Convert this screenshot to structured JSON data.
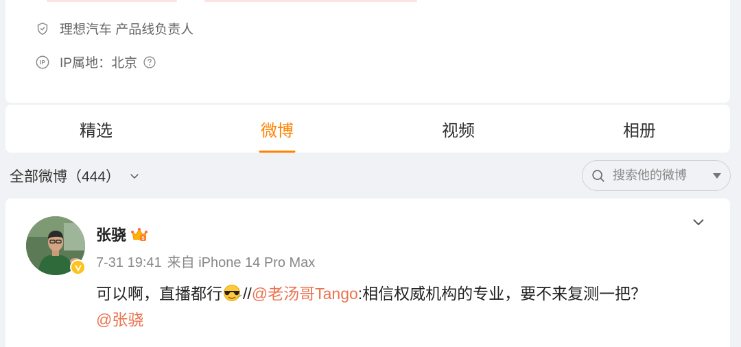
{
  "profile": {
    "company_line": "理想汽车 产品线负责人",
    "ip_line": "IP属地：北京"
  },
  "tabs": [
    {
      "label": "精选",
      "active": false
    },
    {
      "label": "微博",
      "active": true
    },
    {
      "label": "视频",
      "active": false
    },
    {
      "label": "相册",
      "active": false
    }
  ],
  "filter": {
    "label": "全部微博（444）"
  },
  "search": {
    "placeholder": "搜索他的微博"
  },
  "post": {
    "author": "张骁",
    "date": "7-31 19:41",
    "source": "来自 iPhone 14 Pro Max",
    "text_part1": "可以啊，直播都行",
    "emoji": "sunglasses-emoji",
    "text_sep": "//",
    "mention1": "@老汤哥Tango",
    "text_part2": ":相信权威机构的专业，要不来复测一把？",
    "mention2": "@张骁"
  },
  "colors": {
    "accent": "#ff8200",
    "mention": "#eb7350",
    "badge": "#ffc21a"
  }
}
